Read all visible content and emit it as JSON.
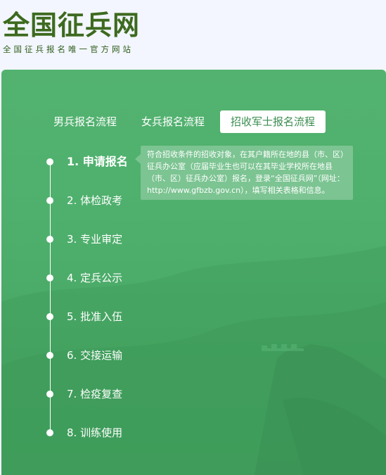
{
  "header": {
    "title": "全国征兵网",
    "subtitle": "全国征兵报名唯一官方网站"
  },
  "tabs": [
    {
      "label": "男兵报名流程",
      "active": false
    },
    {
      "label": "女兵报名流程",
      "active": false
    },
    {
      "label": "招收军士报名流程",
      "active": true
    }
  ],
  "steps": [
    {
      "label": "1. 申请报名",
      "active": true
    },
    {
      "label": "2. 体检政考",
      "active": false
    },
    {
      "label": "3. 专业审定",
      "active": false
    },
    {
      "label": "4. 定兵公示",
      "active": false
    },
    {
      "label": "5. 批准入伍",
      "active": false
    },
    {
      "label": "6. 交接运输",
      "active": false
    },
    {
      "label": "7. 检疫复查",
      "active": false
    },
    {
      "label": "8. 训练使用",
      "active": false
    }
  ],
  "description": "符合招收条件的招收对象，在其户籍所在地的县（市、区）征兵办公室（应届毕业生也可以在其毕业学校所在地县（市、区）征兵办公室）报名，登录“全国征兵网”（网址：http://www.gfbzb.gov.cn），填写相关表格和信息。",
  "colors": {
    "logo": "#3d6a1f",
    "panel": "#4fb06d",
    "active_tab_text": "#3a8d4f"
  }
}
